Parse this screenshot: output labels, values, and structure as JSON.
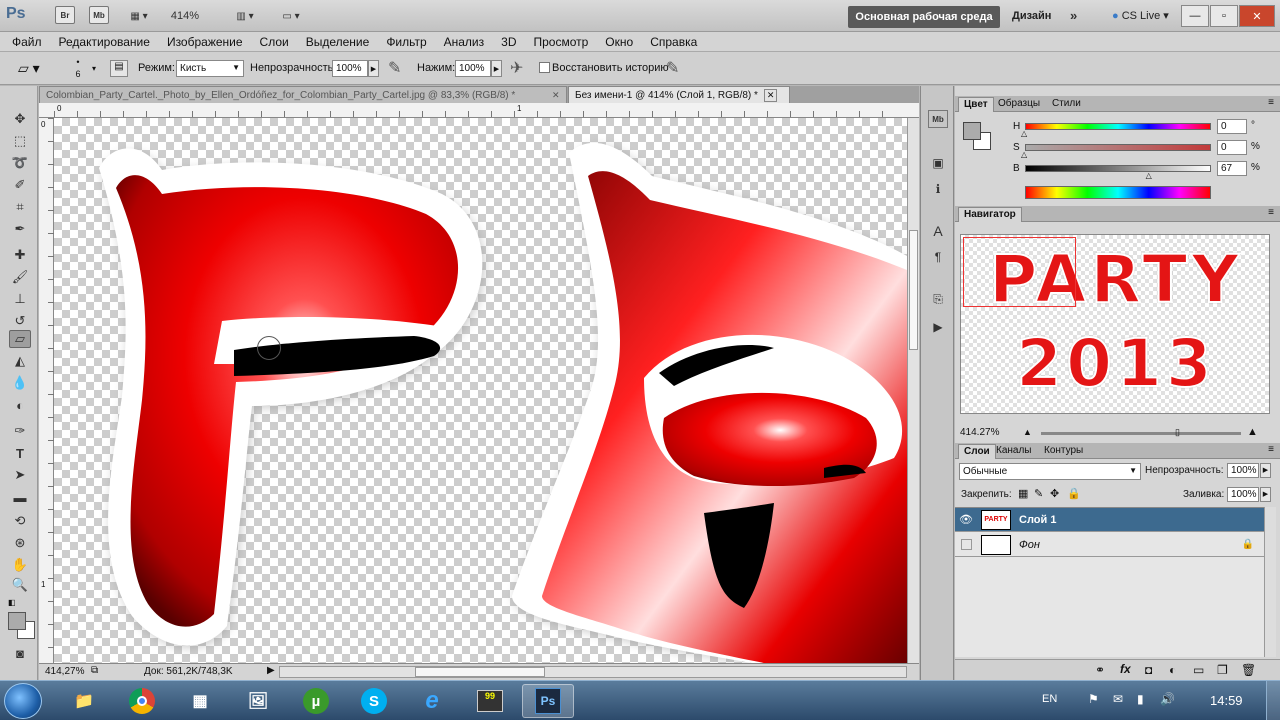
{
  "titlebar": {
    "logo": "Ps",
    "icons": [
      "Br",
      "Mb"
    ],
    "zoom": "414%",
    "workspace_active": "Основная рабочая среда",
    "workspace_design": "Дизайн",
    "more": "»",
    "cslive": "CS Live",
    "win_min": "—",
    "win_max": "▫",
    "win_close": "✕"
  },
  "menu": [
    "Файл",
    "Редактирование",
    "Изображение",
    "Слои",
    "Выделение",
    "Фильтр",
    "Анализ",
    "3D",
    "Просмотр",
    "Окно",
    "Справка"
  ],
  "options": {
    "brush_size": "6",
    "mode_label": "Режим:",
    "mode_value": "Кисть",
    "opacity_label": "Непрозрачность:",
    "opacity_value": "100%",
    "flow_label": "Нажим:",
    "flow_value": "100%",
    "history_label": "Восстановить историю"
  },
  "documents": {
    "tab1": "Colombian_Party_Cartel._Photo_by_Ellen_Ordóñez_for_Colombian_Party_Cartel.jpg @ 83,3% (RGB/8) *",
    "tab2": "Без имени-1 @ 414% (Слой 1, RGB/8) *",
    "close": "✕",
    "ruler_top": [
      "0",
      "1"
    ],
    "ruler_left": [
      "0",
      "1"
    ],
    "zoom_status": "414,27%",
    "doc_status": "Док: 561,2K/748,3K"
  },
  "color_panel": {
    "tabs": [
      "Цвет",
      "Образцы",
      "Стили"
    ],
    "h_label": "H",
    "h_value": "0",
    "h_unit": "°",
    "s_label": "S",
    "s_value": "0",
    "s_unit": "%",
    "b_label": "B",
    "b_value": "67",
    "b_unit": "%",
    "slider_positions": {
      "h": 0,
      "s": 0,
      "b": 0.67
    },
    "colors": {
      "foreground": "#ababab",
      "background": "#ffffff"
    }
  },
  "navigator": {
    "title": "Навигатор",
    "preview_line1": "PARTY",
    "preview_line2": "2013",
    "zoom": "414.27%"
  },
  "layers_panel": {
    "tabs": [
      "Слои",
      "Каналы",
      "Контуры"
    ],
    "blend_mode": "Обычные",
    "opacity_label": "Непрозрачность:",
    "opacity_value": "100%",
    "lock_label": "Закрепить:",
    "fill_label": "Заливка:",
    "fill_value": "100%",
    "layers": [
      {
        "name": "Слой 1",
        "thumb": "PARTY",
        "selected": true
      },
      {
        "name": "Фон",
        "selected": false
      }
    ]
  },
  "taskbar": {
    "language": "EN",
    "time": "14:59"
  }
}
